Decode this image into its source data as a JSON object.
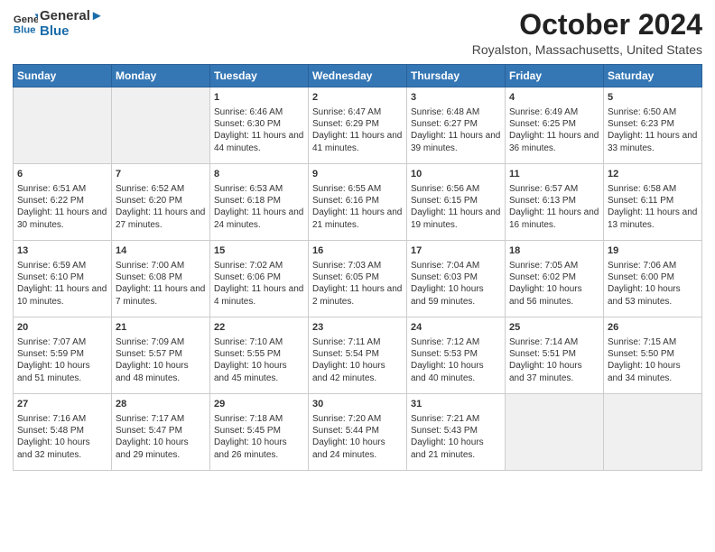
{
  "header": {
    "logo_line1": "General",
    "logo_line2": "Blue",
    "main_title": "October 2024",
    "subtitle": "Royalston, Massachusetts, United States"
  },
  "weekdays": [
    "Sunday",
    "Monday",
    "Tuesday",
    "Wednesday",
    "Thursday",
    "Friday",
    "Saturday"
  ],
  "rows": [
    [
      {
        "day": "",
        "empty": true
      },
      {
        "day": "",
        "empty": true
      },
      {
        "day": "1",
        "sunrise": "6:46 AM",
        "sunset": "6:30 PM",
        "daylight": "11 hours and 44 minutes."
      },
      {
        "day": "2",
        "sunrise": "6:47 AM",
        "sunset": "6:29 PM",
        "daylight": "11 hours and 41 minutes."
      },
      {
        "day": "3",
        "sunrise": "6:48 AM",
        "sunset": "6:27 PM",
        "daylight": "11 hours and 39 minutes."
      },
      {
        "day": "4",
        "sunrise": "6:49 AM",
        "sunset": "6:25 PM",
        "daylight": "11 hours and 36 minutes."
      },
      {
        "day": "5",
        "sunrise": "6:50 AM",
        "sunset": "6:23 PM",
        "daylight": "11 hours and 33 minutes."
      }
    ],
    [
      {
        "day": "6",
        "sunrise": "6:51 AM",
        "sunset": "6:22 PM",
        "daylight": "11 hours and 30 minutes."
      },
      {
        "day": "7",
        "sunrise": "6:52 AM",
        "sunset": "6:20 PM",
        "daylight": "11 hours and 27 minutes."
      },
      {
        "day": "8",
        "sunrise": "6:53 AM",
        "sunset": "6:18 PM",
        "daylight": "11 hours and 24 minutes."
      },
      {
        "day": "9",
        "sunrise": "6:55 AM",
        "sunset": "6:16 PM",
        "daylight": "11 hours and 21 minutes."
      },
      {
        "day": "10",
        "sunrise": "6:56 AM",
        "sunset": "6:15 PM",
        "daylight": "11 hours and 19 minutes."
      },
      {
        "day": "11",
        "sunrise": "6:57 AM",
        "sunset": "6:13 PM",
        "daylight": "11 hours and 16 minutes."
      },
      {
        "day": "12",
        "sunrise": "6:58 AM",
        "sunset": "6:11 PM",
        "daylight": "11 hours and 13 minutes."
      }
    ],
    [
      {
        "day": "13",
        "sunrise": "6:59 AM",
        "sunset": "6:10 PM",
        "daylight": "11 hours and 10 minutes."
      },
      {
        "day": "14",
        "sunrise": "7:00 AM",
        "sunset": "6:08 PM",
        "daylight": "11 hours and 7 minutes."
      },
      {
        "day": "15",
        "sunrise": "7:02 AM",
        "sunset": "6:06 PM",
        "daylight": "11 hours and 4 minutes."
      },
      {
        "day": "16",
        "sunrise": "7:03 AM",
        "sunset": "6:05 PM",
        "daylight": "11 hours and 2 minutes."
      },
      {
        "day": "17",
        "sunrise": "7:04 AM",
        "sunset": "6:03 PM",
        "daylight": "10 hours and 59 minutes."
      },
      {
        "day": "18",
        "sunrise": "7:05 AM",
        "sunset": "6:02 PM",
        "daylight": "10 hours and 56 minutes."
      },
      {
        "day": "19",
        "sunrise": "7:06 AM",
        "sunset": "6:00 PM",
        "daylight": "10 hours and 53 minutes."
      }
    ],
    [
      {
        "day": "20",
        "sunrise": "7:07 AM",
        "sunset": "5:59 PM",
        "daylight": "10 hours and 51 minutes."
      },
      {
        "day": "21",
        "sunrise": "7:09 AM",
        "sunset": "5:57 PM",
        "daylight": "10 hours and 48 minutes."
      },
      {
        "day": "22",
        "sunrise": "7:10 AM",
        "sunset": "5:55 PM",
        "daylight": "10 hours and 45 minutes."
      },
      {
        "day": "23",
        "sunrise": "7:11 AM",
        "sunset": "5:54 PM",
        "daylight": "10 hours and 42 minutes."
      },
      {
        "day": "24",
        "sunrise": "7:12 AM",
        "sunset": "5:53 PM",
        "daylight": "10 hours and 40 minutes."
      },
      {
        "day": "25",
        "sunrise": "7:14 AM",
        "sunset": "5:51 PM",
        "daylight": "10 hours and 37 minutes."
      },
      {
        "day": "26",
        "sunrise": "7:15 AM",
        "sunset": "5:50 PM",
        "daylight": "10 hours and 34 minutes."
      }
    ],
    [
      {
        "day": "27",
        "sunrise": "7:16 AM",
        "sunset": "5:48 PM",
        "daylight": "10 hours and 32 minutes."
      },
      {
        "day": "28",
        "sunrise": "7:17 AM",
        "sunset": "5:47 PM",
        "daylight": "10 hours and 29 minutes."
      },
      {
        "day": "29",
        "sunrise": "7:18 AM",
        "sunset": "5:45 PM",
        "daylight": "10 hours and 26 minutes."
      },
      {
        "day": "30",
        "sunrise": "7:20 AM",
        "sunset": "5:44 PM",
        "daylight": "10 hours and 24 minutes."
      },
      {
        "day": "31",
        "sunrise": "7:21 AM",
        "sunset": "5:43 PM",
        "daylight": "10 hours and 21 minutes."
      },
      {
        "day": "",
        "empty": true
      },
      {
        "day": "",
        "empty": true
      }
    ]
  ]
}
